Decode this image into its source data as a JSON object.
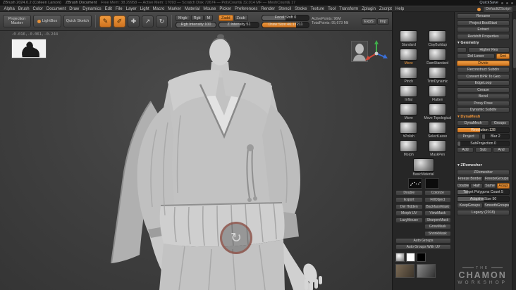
{
  "titlebar": {
    "app": "ZBrush 2024.0.2 (Colleen Larson)",
    "doc": "ZBrush Document",
    "stats": "Free Mem: 38.29958 — Active Mem: 17093 — Scratch Disk 72674 — PolyCount& 32,014 MF — MeshCount& 17",
    "quicksave": "QuickSave"
  },
  "menubar": {
    "items": [
      "Alpha",
      "Brush",
      "Color",
      "Document",
      "Draw",
      "Dynamics",
      "Edit",
      "File",
      "Layer",
      "Light",
      "Macro",
      "Marker",
      "Material",
      "Mouse",
      "Picker",
      "Preferences",
      "Render",
      "Stencil",
      "Stroke",
      "Texture",
      "Tool",
      "Transform",
      "Zplugin",
      "Zscript",
      "Help"
    ],
    "right_label": "DefaultZScript"
  },
  "icons": {
    "edit": "✎",
    "draw": "✐",
    "move": "✚",
    "scale": "↗",
    "rotate": "↻",
    "rotate_widget": "↻"
  },
  "toolbar": {
    "projection_master": "Projection Master",
    "lightbox": "LightBox",
    "quick_sketch": "Quick Sketch",
    "mrgb": "Mrgb",
    "rgb": "Rgb",
    "m": "M",
    "rgb_intensity": "Rgb Intensity 100",
    "zadd": "Zadd",
    "zsub": "Zsub",
    "z_intensity": "Z Intensity 51",
    "focal_shift": "Focal Shift 0",
    "draw_size": "Draw Size 46.17211",
    "active_points": "ActivePoints: 96M",
    "total_points": "TotalPoints: 95,673 Mil",
    "exp": "ExpS",
    "imp": "Imp"
  },
  "canvas": {
    "coords": "-0.016,-0.061,-0.244"
  },
  "strip": {
    "brushes": [
      {
        "n": "Standard"
      },
      {
        "n": "ClayBuildup"
      },
      {
        "n": "Move",
        "accent": true
      },
      {
        "n": "DamStandard"
      },
      {
        "n": "Pinch"
      },
      {
        "n": "TrimDynamic"
      },
      {
        "n": "Inflat"
      },
      {
        "n": "Flatten"
      },
      {
        "n": "Move"
      },
      {
        "n": "Move Topological"
      },
      {
        "n": "hPolish"
      },
      {
        "n": "SelectLasso"
      },
      {
        "n": "Morph"
      },
      {
        "n": "MaskPen"
      }
    ],
    "material": "BasicMaterial",
    "toggles": [
      "Double",
      "Colorize"
    ],
    "button_rows": [
      {
        "l": "Export",
        "r": "FillObject"
      },
      {
        "l": "Del Hidden",
        "r": "BackfaceMask"
      },
      {
        "l": "Morph UV",
        "r": "ViewMask"
      },
      {
        "l": "LazyMouse",
        "r": "SharpenMask"
      },
      {
        "l": "",
        "r": "GrowMask"
      },
      {
        "l": "",
        "r": "ShrinkMask"
      }
    ],
    "wide_buttons": [
      "Auto Groups",
      "Auto Groups With UV"
    ],
    "swatches": [
      {
        "name": "switch-color-swatch",
        "cls": "grad"
      },
      {
        "name": "white-swatch",
        "cls": "white"
      },
      {
        "name": "black-swatch",
        "cls": "black"
      }
    ],
    "textures": [
      {
        "name": "texture-thumb-1",
        "cls": "tex-a"
      },
      {
        "name": "texture-thumb-2",
        "cls": "tex-b"
      }
    ]
  },
  "tool_panel": {
    "rows": [
      {
        "cells": [
          {
            "t": "btn",
            "label": "Rename"
          }
        ]
      },
      {
        "cells": [
          {
            "t": "btn",
            "label": "Project BoolStart"
          }
        ]
      },
      {
        "cells": [
          {
            "t": "btn",
            "label": "Extract"
          }
        ]
      },
      {
        "cells": [
          {
            "t": "btn",
            "label": "Redshift Properties"
          }
        ]
      },
      {
        "cells": [
          {
            "t": "sect",
            "label": "Geometry"
          }
        ]
      },
      {
        "cells": [
          {
            "t": "btn",
            "label": "",
            "w": "0.35"
          },
          {
            "t": "btn",
            "label": "Higher Res",
            "w": "1.65"
          }
        ]
      },
      {
        "cells": [
          {
            "t": "btn",
            "label": "Del Lower",
            "w": "1.5"
          },
          {
            "t": "btn",
            "label": "Smt",
            "w": "0.5",
            "accent": true
          }
        ]
      },
      {
        "cells": [
          {
            "t": "btn",
            "label": "Divide",
            "accent": true
          }
        ]
      },
      {
        "cells": [
          {
            "t": "btn",
            "label": "Reconstruct Subdiv"
          }
        ]
      },
      {
        "cells": [
          {
            "t": "btn",
            "label": "Convert BPR To Geo"
          }
        ]
      },
      {
        "cells": [
          {
            "t": "btn",
            "label": "EdgeLoop"
          }
        ]
      },
      {
        "cells": [
          {
            "t": "btn",
            "label": "Crease"
          }
        ]
      },
      {
        "cells": [
          {
            "t": "btn",
            "label": "Bevel"
          }
        ]
      },
      {
        "cells": [
          {
            "t": "btn",
            "label": "Proxy Pose"
          }
        ]
      },
      {
        "cells": [
          {
            "t": "btn",
            "label": "Dynamic Subdiv"
          }
        ]
      },
      {
        "cells": [
          {
            "t": "sect",
            "label": "DynaMesh",
            "accent": true
          }
        ]
      },
      {
        "cells": [
          {
            "t": "btn",
            "label": "DynaMesh",
            "w": "1.4"
          },
          {
            "t": "btn",
            "label": "Groups",
            "w": "0.8"
          }
        ]
      },
      {
        "cells": [
          {
            "t": "sldr",
            "label": "Resolution 128",
            "fill": 44,
            "accent": true
          }
        ]
      },
      {
        "cells": [
          {
            "t": "btn",
            "label": "Project",
            "w": "0.9"
          },
          {
            "t": "sldr",
            "label": "Blur 2",
            "fill": 12,
            "w": "1.1"
          }
        ]
      },
      {
        "cells": [
          {
            "t": "sldr",
            "label": "SubProjection 0",
            "fill": 5
          }
        ]
      },
      {
        "cells": [
          {
            "t": "btn",
            "label": "Add"
          },
          {
            "t": "btn",
            "label": "Sub"
          },
          {
            "t": "btn",
            "label": "And"
          }
        ]
      },
      {
        "cells": [
          {
            "t": "gap",
            "label": ""
          }
        ]
      },
      {
        "cells": [
          {
            "t": "sect",
            "label": "ZRemesher"
          }
        ]
      },
      {
        "cells": [
          {
            "t": "btn",
            "label": "ZRemesher"
          }
        ]
      },
      {
        "cells": [
          {
            "t": "btn",
            "label": "Freeze Border"
          },
          {
            "t": "btn",
            "label": "FreezeGroups"
          }
        ]
      },
      {
        "cells": [
          {
            "t": "btn",
            "label": "Double"
          },
          {
            "t": "btn",
            "label": "Half"
          },
          {
            "t": "btn",
            "label": "Same"
          },
          {
            "t": "btn",
            "label": "Adapt",
            "accent": true
          }
        ]
      },
      {
        "cells": [
          {
            "t": "sldr",
            "label": "Target Polygons Count 5",
            "fill": 20
          }
        ]
      },
      {
        "cells": [
          {
            "t": "sldr",
            "label": "AdaptiveSize 50",
            "fill": 50
          }
        ]
      },
      {
        "cells": [
          {
            "t": "btn",
            "label": "KeepGroups"
          },
          {
            "t": "btn",
            "label": "SmoothGroups 0"
          }
        ]
      },
      {
        "cells": [
          {
            "t": "btn",
            "label": "Legacy (2018)"
          }
        ]
      }
    ]
  },
  "logo": {
    "top": "THE",
    "main": "CHAMON",
    "sub": "WORKSHOP"
  },
  "colors": {
    "accent": "#e8923a",
    "canvas_bg": "#3f3f3f",
    "panel_bg": "#303030"
  }
}
